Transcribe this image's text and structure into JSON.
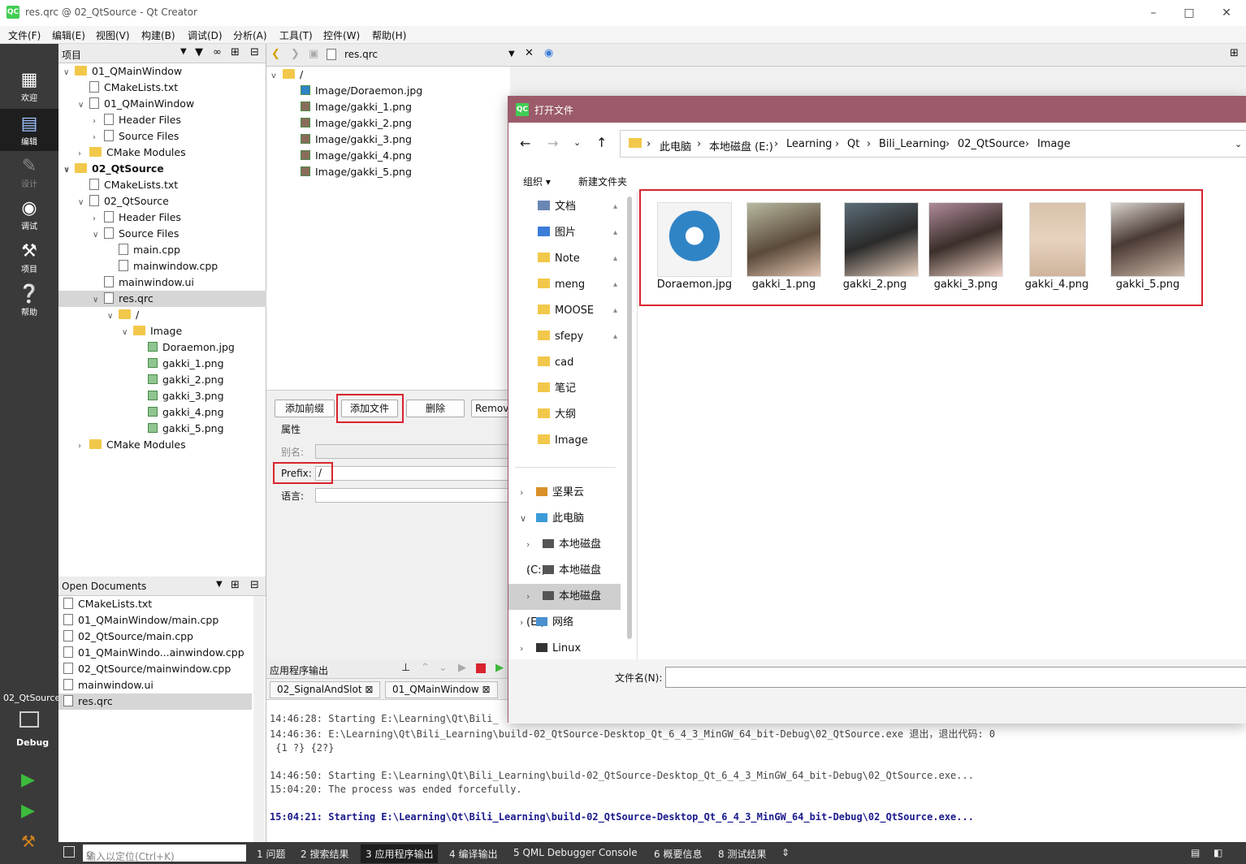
{
  "window": {
    "title": "res.qrc @ 02_QtSource - Qt Creator",
    "app_icon": "QC"
  },
  "menu": [
    "文件(F)",
    "编辑(E)",
    "视图(V)",
    "构建(B)",
    "调试(D)",
    "分析(A)",
    "工具(T)",
    "控件(W)",
    "帮助(H)"
  ],
  "modes": [
    {
      "label": "欢迎",
      "icon": "welcome-grid-icon"
    },
    {
      "label": "编辑",
      "icon": "edit-icon"
    },
    {
      "label": "设计",
      "icon": "design-pencil-icon"
    },
    {
      "label": "调试",
      "icon": "debug-bug-icon"
    },
    {
      "label": "项目",
      "icon": "project-wrench-icon"
    },
    {
      "label": "帮助",
      "icon": "help-icon"
    }
  ],
  "kit": {
    "project": "02_QtSource",
    "mode": "Debug"
  },
  "project_pane": {
    "title": "项目"
  },
  "tree": [
    {
      "label": "01_QMainWindow",
      "d": 0,
      "a": "v",
      "k": "proj",
      "b": false
    },
    {
      "label": "CMakeLists.txt",
      "d": 1,
      "a": "",
      "k": "file",
      "b": false
    },
    {
      "label": "01_QMainWindow",
      "d": 1,
      "a": "v",
      "k": "target",
      "b": false
    },
    {
      "label": "Header Files",
      "d": 2,
      "a": ">",
      "k": "hdr",
      "b": false
    },
    {
      "label": "Source Files",
      "d": 2,
      "a": ">",
      "k": "hdr",
      "b": false
    },
    {
      "label": "CMake Modules",
      "d": 1,
      "a": ">",
      "k": "cmake",
      "b": false
    },
    {
      "label": "02_QtSource",
      "d": 0,
      "a": "v",
      "k": "proj",
      "b": true
    },
    {
      "label": "CMakeLists.txt",
      "d": 1,
      "a": "",
      "k": "file",
      "b": false
    },
    {
      "label": "02_QtSource",
      "d": 1,
      "a": "v",
      "k": "target",
      "b": false
    },
    {
      "label": "Header Files",
      "d": 2,
      "a": ">",
      "k": "hdr",
      "b": false
    },
    {
      "label": "Source Files",
      "d": 2,
      "a": "v",
      "k": "hdr",
      "b": false
    },
    {
      "label": "main.cpp",
      "d": 3,
      "a": "",
      "k": "file",
      "b": false
    },
    {
      "label": "mainwindow.cpp",
      "d": 3,
      "a": "",
      "k": "file",
      "b": false
    },
    {
      "label": "mainwindow.ui",
      "d": 2,
      "a": "",
      "k": "file",
      "b": false
    },
    {
      "label": "res.qrc",
      "d": 2,
      "a": "v",
      "k": "file",
      "b": false,
      "sel": true
    },
    {
      "label": "/",
      "d": 3,
      "a": "v",
      "k": "folder",
      "b": false
    },
    {
      "label": "Image",
      "d": 4,
      "a": "v",
      "k": "folder",
      "b": false
    },
    {
      "label": "Doraemon.jpg",
      "d": 5,
      "a": "",
      "k": "img",
      "b": false
    },
    {
      "label": "gakki_1.png",
      "d": 5,
      "a": "",
      "k": "img",
      "b": false
    },
    {
      "label": "gakki_2.png",
      "d": 5,
      "a": "",
      "k": "img",
      "b": false
    },
    {
      "label": "gakki_3.png",
      "d": 5,
      "a": "",
      "k": "img",
      "b": false
    },
    {
      "label": "gakki_4.png",
      "d": 5,
      "a": "",
      "k": "img",
      "b": false
    },
    {
      "label": "gakki_5.png",
      "d": 5,
      "a": "",
      "k": "img",
      "b": false
    },
    {
      "label": "CMake Modules",
      "d": 1,
      "a": ">",
      "k": "cmake",
      "b": false
    }
  ],
  "open_documents": {
    "title": "Open Documents",
    "items": [
      "CMakeLists.txt",
      "01_QMainWindow/main.cpp",
      "02_QtSource/main.cpp",
      "01_QMainWindo...ainwindow.cpp",
      "02_QtSource/mainwindow.cpp",
      "mainwindow.ui",
      "res.qrc"
    ]
  },
  "editor": {
    "file": "res.qrc",
    "root": "/",
    "resources": [
      "Image/Doraemon.jpg",
      "Image/gakki_1.png",
      "Image/gakki_2.png",
      "Image/gakki_3.png",
      "Image/gakki_4.png",
      "Image/gakki_5.png"
    ]
  },
  "resource_editor": {
    "add_prefix": "添加前缀",
    "add_files": "添加文件",
    "remove": "删除",
    "remove_missing": "Remov",
    "properties": "属性",
    "alias": "别名:",
    "prefix_label": "Prefix:",
    "prefix_value": "/",
    "language": "语言:"
  },
  "output": {
    "title": "应用程序输出",
    "tabs": [
      "02_SignalAndSlot",
      "01_QMainWindow"
    ],
    "lines": [
      "14:46:28: Starting E:\\Learning\\Qt\\Bili_",
      "14:46:36: E:\\Learning\\Qt\\Bili_Learning\\build-02_QtSource-Desktop_Qt_6_4_3_MinGW_64_bit-Debug\\02_QtSource.exe 退出，退出代码: 0",
      " {1 ?} {2?}",
      "14:46:50: Starting E:\\Learning\\Qt\\Bili_Learning\\build-02_QtSource-Desktop_Qt_6_4_3_MinGW_64_bit-Debug\\02_QtSource.exe...",
      "15:04:20: The process was ended forcefully.",
      "15:04:21: Starting E:\\Learning\\Qt\\Bili_Learning\\build-02_QtSource-Desktop_Qt_6_4_3_MinGW_64_bit-Debug\\02_QtSource.exe..."
    ]
  },
  "statusbar": {
    "locator_placeholder": "输入以定位(Ctrl+K)",
    "tabs": [
      "1 问题",
      "2 搜索结果",
      "3 应用程序输出",
      "4 编译输出",
      "5 QML Debugger Console",
      "6 概要信息",
      "8 测试结果"
    ]
  },
  "dialog": {
    "title": "打开文件",
    "breadcrumb": [
      "此电脑",
      "本地磁盘 (E:)",
      "Learning",
      "Qt",
      "Bili_Learning",
      "02_QtSource",
      "Image"
    ],
    "organize": "组织",
    "new_folder": "新建文件夹",
    "sidebar": [
      {
        "label": "文档",
        "icon": "document-icon",
        "pin": true
      },
      {
        "label": "图片",
        "icon": "picture-icon",
        "pin": true
      },
      {
        "label": "Note",
        "icon": "folder-icon",
        "pin": true
      },
      {
        "label": "meng",
        "icon": "folder-icon",
        "pin": true
      },
      {
        "label": "MOOSE",
        "icon": "folder-icon",
        "pin": true
      },
      {
        "label": "sfepy",
        "icon": "folder-icon",
        "pin": true
      },
      {
        "label": "cad",
        "icon": "folder-icon",
        "pin": false
      },
      {
        "label": "笔记",
        "icon": "folder-icon",
        "pin": false
      },
      {
        "label": "大纲",
        "icon": "folder-icon",
        "pin": false
      },
      {
        "label": "Image",
        "icon": "folder-icon",
        "pin": false
      }
    ],
    "tree_nodes": [
      {
        "label": "坚果云",
        "icon": "nutstore-icon",
        "arrow": ">",
        "indent": 0
      },
      {
        "label": "此电脑",
        "icon": "computer-icon",
        "arrow": "v",
        "indent": 0
      },
      {
        "label": "本地磁盘 (C:)",
        "icon": "windows-drive-icon",
        "arrow": ">",
        "indent": 1
      },
      {
        "label": "本地磁盘 (D:)",
        "icon": "drive-icon",
        "arrow": ">",
        "indent": 1
      },
      {
        "label": "本地磁盘 (E:)",
        "icon": "drive-icon",
        "arrow": ">",
        "indent": 1,
        "sel": true
      },
      {
        "label": "网络",
        "icon": "network-icon",
        "arrow": ">",
        "indent": 0
      },
      {
        "label": "Linux",
        "icon": "linux-icon",
        "arrow": ">",
        "indent": 0
      }
    ],
    "files": [
      "Doraemon.jpg",
      "gakki_1.png",
      "gakki_2.png",
      "gakki_3.png",
      "gakki_4.png",
      "gakki_5.png"
    ],
    "filename_label": "文件名(N):"
  },
  "colors": {
    "accent_red": "#d9232e",
    "dialog_title": "#9c5b6a",
    "modebar": "#3a3a3a",
    "output_blue": "#1a1a8c"
  }
}
